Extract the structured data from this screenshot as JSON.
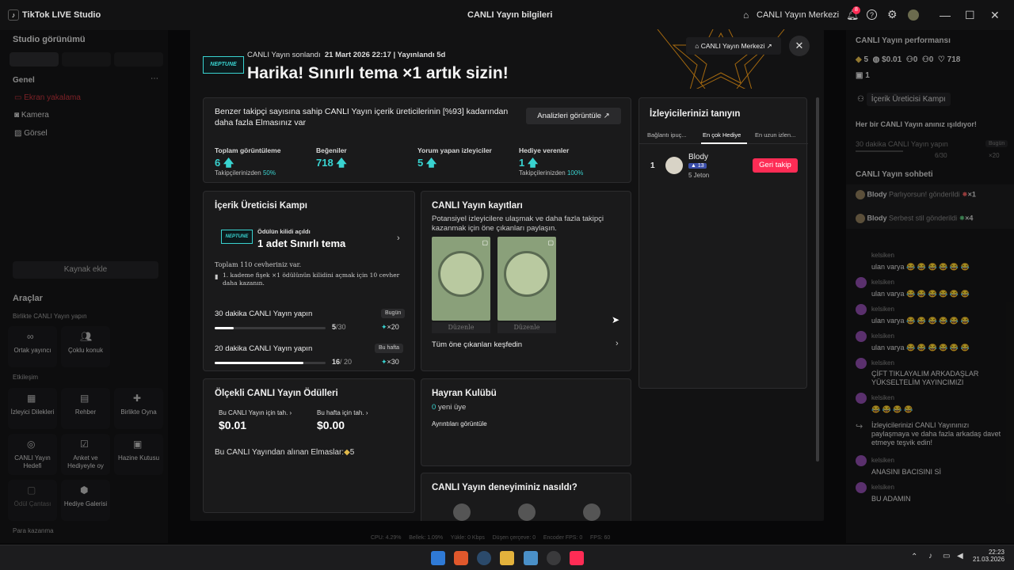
{
  "titlebar": {
    "app_name": "TikTok LIVE Studio",
    "center_title": "CANLI Yayın bilgileri",
    "live_center": "CANLI Yayın Merkezi",
    "notification_count": "8"
  },
  "left_panel": {
    "studio_view": "Studio görünümü",
    "general": "Genel",
    "sources": [
      "Ekran yakalama",
      "Kamera",
      "Görsel"
    ],
    "add_source": "Kaynak ekle",
    "tools_title": "Araçlar",
    "collab_section": "Birlikte CANLI Yayın yapın",
    "collab_tools": [
      "Ortak yayıncı",
      "Çoklu konuk"
    ],
    "interaction_section": "Etkileşim",
    "interaction_tools": [
      "İzleyici Dilekleri",
      "Rehber",
      "Birlikte Oyna",
      "CANLI Yayın Hedefi",
      "Anket ve Hediyeyle oy",
      "Hazine Kutusu",
      "Ödül Çantası",
      "Hediye Galerisi"
    ],
    "monetize_section": "Para kazanma"
  },
  "right_panel": {
    "perf_title": "CANLI Yayın performansı",
    "stats": [
      "5",
      "$0.01",
      "0",
      "0",
      "718",
      "1"
    ],
    "camp_label": "İçerik Üreticisi Kampı",
    "shine_text": "Her bir CANLI Yayın anınız ışıldıyor!",
    "task_text": "30 dakika CANLI Yayın yapın",
    "task_badge": "Bugün",
    "task_progress": "6/30",
    "task_reward": "×20",
    "chat_title": "CANLI Yayın sohbeti",
    "gifts": [
      {
        "user": "Blody",
        "text": "Parlıyorsun! gönderildi",
        "count": "×1"
      },
      {
        "user": "Blody",
        "text": "Serbest stil gönderildi",
        "count": "×4"
      }
    ],
    "messages": [
      {
        "user": "kelsiken",
        "text": "ulan varya 😂 😂 😂 😂 😂 😂"
      },
      {
        "user": "kelsiken",
        "text": "ulan varya 😂 😂 😂 😂 😂 😂"
      },
      {
        "user": "kelsiken",
        "text": "ulan varya 😂 😂 😂 😂 😂 😂"
      },
      {
        "user": "kelsiken",
        "text": "ulan varya 😂 😂 😂 😂 😂 😂"
      },
      {
        "user": "kelsiken",
        "text": "ÇİFT TIKLAYALIM ARKADAŞLAR YÜKSELTELİM YAYINCIMIZI"
      },
      {
        "user": "kelsiken",
        "text": "😂 😂 😂 😂"
      },
      {
        "user": "",
        "text": "İzleyicilerinizi CANLI Yayınınızı paylaşmaya ve daha fazla arkadaş davet etmeye teşvik edin!"
      },
      {
        "user": "kelsiken",
        "text": "ANASINI BACISINI Sİ"
      },
      {
        "user": "kelsiken",
        "text": "BU ADAMIN"
      }
    ]
  },
  "modal": {
    "ended_label": "CANLI Yayın sonlandı",
    "ended_date": "21 Mart 2026 22:17 | Yayınlandı 5d",
    "badge": "NEPTUNE",
    "headline": "Harika! Sınırlı tema ×1 artık sizin!",
    "live_center_button": "CANLI Yayın Merkezi",
    "summary_text": "Benzer takipçi sayısına sahip CANLI Yayın içerik üreticilerinin [%93] kadarından daha fazla Elmasınız var",
    "analytics_button": "Analizleri görüntüle",
    "stats": [
      {
        "label": "Toplam görüntüleme",
        "value": "6",
        "sub_prefix": "Takipçilerinizden",
        "sub_value": "50%"
      },
      {
        "label": "Beğeniler",
        "value": "718",
        "sub_prefix": "",
        "sub_value": ""
      },
      {
        "label": "Yorum yapan izleyiciler",
        "value": "5",
        "sub_prefix": "",
        "sub_value": ""
      },
      {
        "label": "Hediye verenler",
        "value": "1",
        "sub_prefix": "Takipçilerinizden",
        "sub_value": "100%"
      }
    ],
    "camp": {
      "title": "İçerik Üreticisi Kampı",
      "unlocked": "Ödülün kilidi açıldı",
      "reward": "1 adet Sınırlı tema",
      "total": "Toplam 110 cevheriniz var.",
      "hint": "1. kademe fişek ×1 ödülünün kilidini açmak için 10 cevher daha kazanın.",
      "tasks": [
        {
          "name": "30 dakika CANLI Yayın yapın",
          "badge": "Bugün",
          "progress": "5",
          "target": "/30",
          "reward": "×20",
          "fraction": 0.17
        },
        {
          "name": "20 dakika CANLI Yayın yapın",
          "badge": "Bu hafta",
          "progress": "16",
          "target": "/ 20",
          "reward": "×30",
          "fraction": 0.8
        }
      ]
    },
    "records": {
      "title": "CANLI Yayın kayıtları",
      "desc": "Potansiyel izleyicilere ulaşmak ve daha fazla takipçi kazanmak için öne çıkanları paylaşın.",
      "edit1": "Düzenle",
      "edit2": "Düzenle",
      "explore": "Tüm öne çıkanları keşfedin"
    },
    "scaled": {
      "title": "Ölçekli CANLI Yayın Ödülleri",
      "col1_label": "Bu CANLI Yayın için tah.",
      "col1_value": "$0.01",
      "col2_label": "Bu hafta için tah.",
      "col2_value": "$0.00",
      "diamonds": "Bu CANLI Yayından alınan Elmaslar:",
      "diamonds_value": "5"
    },
    "fanclub": {
      "title": "Hayran Kulübü",
      "new_count": "0",
      "new_label": "yeni üye",
      "details": "Ayrıntıları görüntüle"
    },
    "experience": {
      "title": "CANLI Yayın deneyiminiz nasıldı?"
    },
    "viewers": {
      "title": "İzleyicilerinizi tanıyın",
      "tabs": [
        "Bağlantı ipuç...",
        "En çok Hediye",
        "En uzun izlen..."
      ],
      "rank": "1",
      "name": "Blody",
      "level": "13",
      "coins": "5 Jeton",
      "follow_button": "Geri takip"
    }
  },
  "statusbar": {
    "items": [
      "CPU: 4.29%",
      "Bellek: 1.09%",
      "Yükle: 0 Kbps",
      "Düşen çerçeve: 0",
      "Encoder FPS: 0",
      "FPS: 60"
    ]
  },
  "taskbar": {
    "time": "22:23",
    "date": "21.03.2026"
  },
  "colors": {
    "accent": "#39d3d0",
    "pink": "#fe2c55",
    "bg": "#121213"
  }
}
